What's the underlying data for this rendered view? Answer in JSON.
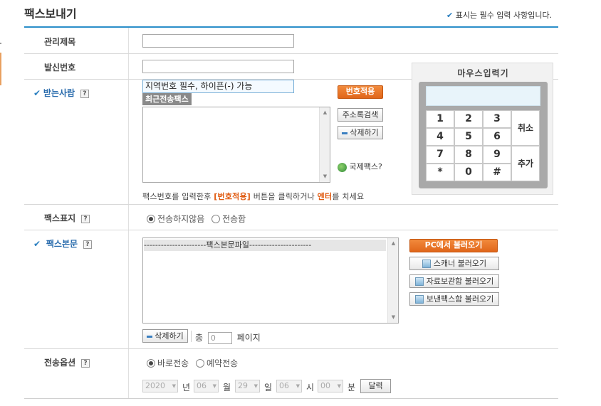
{
  "page": {
    "title": "팩스보내기",
    "required_note": "표시는 필수 입력 사항입니다.",
    "check_glyph": "✔"
  },
  "fields": {
    "subject_label": "관리제목",
    "sender_label": "발신번호",
    "recipient_label": "받는사람",
    "help_glyph": "?",
    "recipient_placeholder": "지역번호 필수, 하이픈(-) 가능",
    "recent_tab": "최근전송팩스",
    "apply_number_btn": "번호적용",
    "address_search_btn": "주소록검색",
    "delete_btn": "삭제하기",
    "intl_fax_link": "국제팩스?",
    "hint_parts": [
      "팩스번호를 입력한후 ",
      "[번호적용]",
      " 버튼을 클릭하거나 ",
      "엔터",
      "를 치세요"
    ]
  },
  "keypad": {
    "title": "마우스입력기",
    "keys": [
      "1",
      "2",
      "3",
      "4",
      "5",
      "6",
      "7",
      "8",
      "9",
      "*",
      "0",
      "#"
    ],
    "cancel": "취소",
    "add": "추가"
  },
  "cover": {
    "label": "팩스표지",
    "option_none": "전송하지않음",
    "option_send": "전송함",
    "selected": "전송하지않음"
  },
  "body": {
    "label": "팩스본문",
    "file_header": "----------------------팩스본문파일----------------------",
    "pc_load_btn": "PC에서 불러오기",
    "scanner_btn": "스캐너 불러오기",
    "archive_btn": "자료보관함 불러오기",
    "sent_box_btn": "보낸팩스함 불러오기",
    "delete_btn": "삭제하기",
    "total_label": "총",
    "page_count": "0",
    "pages_label": "페이지"
  },
  "send_options": {
    "label": "전송옵션",
    "immediate": "바로전송",
    "scheduled": "예약전송",
    "selected": "바로전송",
    "year": "2020",
    "year_unit": "년",
    "month": "06",
    "month_unit": "월",
    "day": "29",
    "day_unit": "일",
    "hour": "06",
    "hour_unit": "시",
    "minute": "00",
    "minute_unit": "분",
    "calendar_btn": "달력"
  },
  "colors": {
    "accent_blue": "#2b8fc9",
    "orange": "#e0661a",
    "label_blue": "#2a6cad"
  }
}
